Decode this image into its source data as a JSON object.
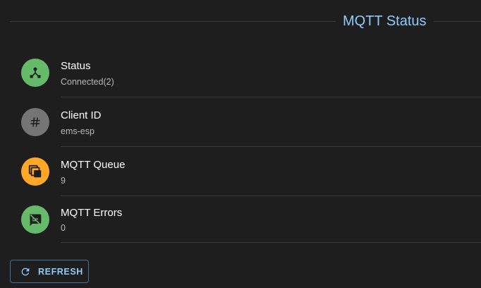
{
  "header": {
    "title": "MQTT Status"
  },
  "items": [
    {
      "label": "Status",
      "value": "Connected(2)",
      "icon": "device-hub-icon",
      "color": "#66bb6a"
    },
    {
      "label": "Client ID",
      "value": "ems-esp",
      "icon": "hashtag-icon",
      "color": "#757575"
    },
    {
      "label": "MQTT Queue",
      "value": "9",
      "icon": "queue-icon",
      "color": "#ffa726"
    },
    {
      "label": "MQTT Errors",
      "value": "0",
      "icon": "speaker-notes-off-icon",
      "color": "#66bb6a"
    }
  ],
  "actions": {
    "refresh_label": "REFRESH",
    "refresh_icon": "refresh-icon",
    "accent": "#90caf9"
  }
}
